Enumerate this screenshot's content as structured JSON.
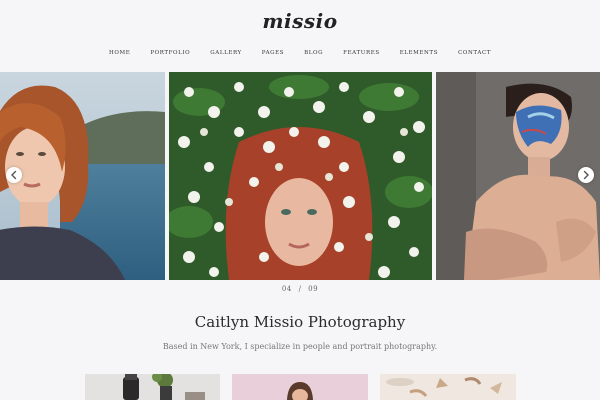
{
  "header": {
    "logo": "missio",
    "nav": [
      "HOME",
      "PORTFOLIO",
      "GALLERY",
      "PAGES",
      "BLOG",
      "FEATURES",
      "ELEMENTS",
      "CONTACT"
    ]
  },
  "slider": {
    "current": "04",
    "separator": "/",
    "total": "09",
    "arrow_left_icon": "chevron-left-icon",
    "arrow_right_icon": "chevron-right-icon"
  },
  "intro": {
    "title": "Caitlyn Missio Photography",
    "tagline": "Based in New York, I specialize in people and portrait photography."
  },
  "colors": {
    "background": "#f6f6f8",
    "text": "#2b2b2b",
    "muted": "#777777"
  }
}
